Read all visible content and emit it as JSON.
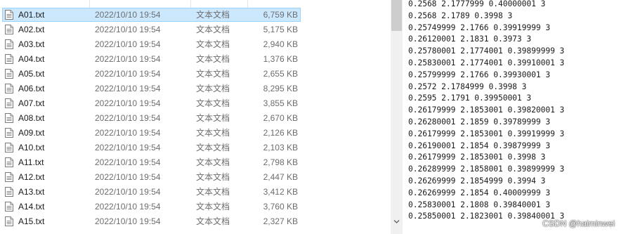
{
  "file_list": {
    "files": [
      {
        "name": "A01.txt",
        "date": "2022/10/10 19:54",
        "type": "文本文档",
        "size": "6,759 KB",
        "selected": true
      },
      {
        "name": "A02.txt",
        "date": "2022/10/10 19:54",
        "type": "文本文档",
        "size": "5,175 KB"
      },
      {
        "name": "A03.txt",
        "date": "2022/10/10 19:54",
        "type": "文本文档",
        "size": "2,940 KB"
      },
      {
        "name": "A04.txt",
        "date": "2022/10/10 19:54",
        "type": "文本文档",
        "size": "1,376 KB"
      },
      {
        "name": "A05.txt",
        "date": "2022/10/10 19:54",
        "type": "文本文档",
        "size": "2,655 KB"
      },
      {
        "name": "A06.txt",
        "date": "2022/10/10 19:54",
        "type": "文本文档",
        "size": "8,295 KB"
      },
      {
        "name": "A07.txt",
        "date": "2022/10/10 19:54",
        "type": "文本文档",
        "size": "3,855 KB"
      },
      {
        "name": "A08.txt",
        "date": "2022/10/10 19:54",
        "type": "文本文档",
        "size": "2,670 KB"
      },
      {
        "name": "A09.txt",
        "date": "2022/10/10 19:54",
        "type": "文本文档",
        "size": "2,126 KB"
      },
      {
        "name": "A10.txt",
        "date": "2022/10/10 19:54",
        "type": "文本文档",
        "size": "2,103 KB"
      },
      {
        "name": "A11.txt",
        "date": "2022/10/10 19:54",
        "type": "文本文档",
        "size": "2,798 KB"
      },
      {
        "name": "A12.txt",
        "date": "2022/10/10 19:54",
        "type": "文本文档",
        "size": "2,447 KB"
      },
      {
        "name": "A13.txt",
        "date": "2022/10/10 19:54",
        "type": "文本文档",
        "size": "3,412 KB"
      },
      {
        "name": "A14.txt",
        "date": "2022/10/10 19:54",
        "type": "文本文档",
        "size": "3,760 KB"
      },
      {
        "name": "A15.txt",
        "date": "2022/10/10 19:54",
        "type": "文本文档",
        "size": "2,327 KB"
      }
    ]
  },
  "text_viewer": {
    "lines": [
      "0.2568 2.1777999 0.40000001 3",
      "0.2568 2.1789 0.3998 3",
      "0.25749999 2.1766 0.39919999 3",
      "0.26120001 2.1831 0.3973 3",
      "0.25780001 2.1774001 0.39899999 3",
      "0.25830001 2.1774001 0.39910001 3",
      "0.25799999 2.1766 0.39930001 3",
      "0.2572 2.1784999 0.3998 3",
      "0.2595 2.1791 0.39950001 3",
      "0.26179999 2.1853001 0.39820001 3",
      "0.26280001 2.1859 0.39789999 3",
      "0.26179999 2.1853001 0.39919999 3",
      "0.26190001 2.1854 0.39879999 3",
      "0.26179999 2.1853001 0.3998 3",
      "0.26289999 2.1858001 0.39899999 3",
      "0.26269999 2.1854999 0.3994 3",
      "0.26269999 2.1854 0.40009999 3",
      "0.25830001 2.1808 0.39840001 3",
      "0.25850001 2.1823001 0.39840001 3"
    ],
    "watermark": "CSDN @haiminwei"
  },
  "colors": {
    "selected_row_bg": "#cce8ff",
    "selected_row_border": "#99d1ff",
    "secondary_text": "#6d6d6d",
    "scrollbar_track": "#f0f0f0",
    "scrollbar_thumb": "#cdcdcd"
  },
  "icons": {
    "file": "text-document-icon",
    "scroll_down": "chevron-down-icon"
  }
}
